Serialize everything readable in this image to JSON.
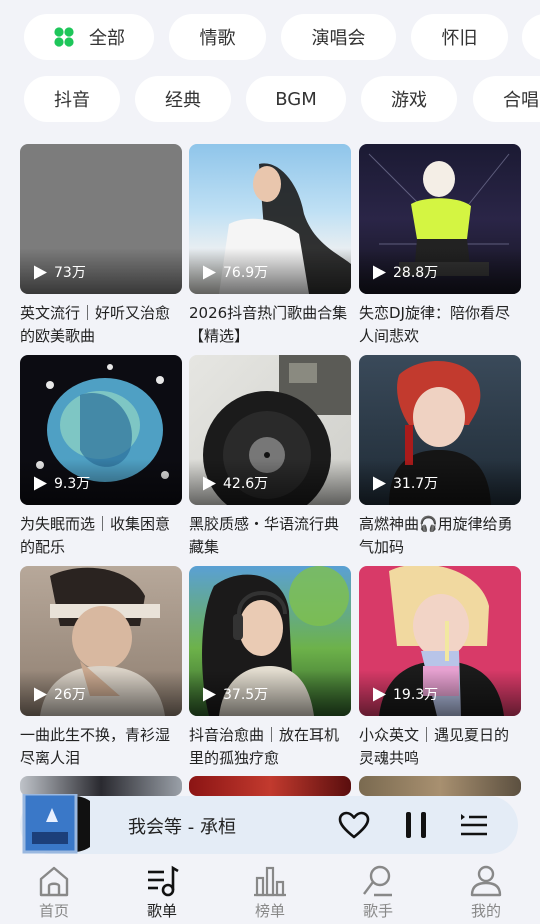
{
  "filters": {
    "row1": [
      {
        "label": "全部",
        "icon": "grid-dots-icon",
        "active": true
      },
      {
        "label": "情歌"
      },
      {
        "label": "演唱会"
      },
      {
        "label": "怀旧"
      },
      {
        "label": ""
      }
    ],
    "row2": [
      {
        "label": "抖音"
      },
      {
        "label": "经典"
      },
      {
        "label": "BGM"
      },
      {
        "label": "游戏"
      },
      {
        "label": "合唱"
      }
    ]
  },
  "playlists": [
    {
      "title": "英文流行｜好听又治愈的欧美歌曲",
      "plays": "73万"
    },
    {
      "title": "2026抖音热门歌曲合集【精选】",
      "plays": "76.9万"
    },
    {
      "title": "失恋DJ旋律：陪你看尽人间悲欢",
      "plays": "28.8万"
    },
    {
      "title": "为失眠而选｜收集困意的配乐",
      "plays": "9.3万"
    },
    {
      "title": "黑胶质感・华语流行典藏集",
      "plays": "42.6万"
    },
    {
      "title": "高燃神曲🎧用旋律给勇气加码",
      "plays": "31.7万"
    },
    {
      "title": "一曲此生不换，青衫湿尽离人泪",
      "plays": "26万"
    },
    {
      "title": "抖音治愈曲｜放在耳机里的孤独疗愈",
      "plays": "37.5万"
    },
    {
      "title": "小众英文｜遇见夏日的灵魂共鸣",
      "plays": "19.3万"
    }
  ],
  "player": {
    "now_playing": "我会等 - 承桓",
    "state": "playing"
  },
  "tabs": [
    {
      "label": "首页",
      "icon": "home-icon"
    },
    {
      "label": "歌单",
      "icon": "playlist-music-icon",
      "active": true
    },
    {
      "label": "榜单",
      "icon": "chart-bars-icon"
    },
    {
      "label": "歌手",
      "icon": "singer-icon"
    },
    {
      "label": "我的",
      "icon": "profile-icon"
    }
  ],
  "colors": {
    "page_bg": "#f2f3f8",
    "accent_green": "#1ec65a",
    "player_bg": "#e4ecf6"
  }
}
